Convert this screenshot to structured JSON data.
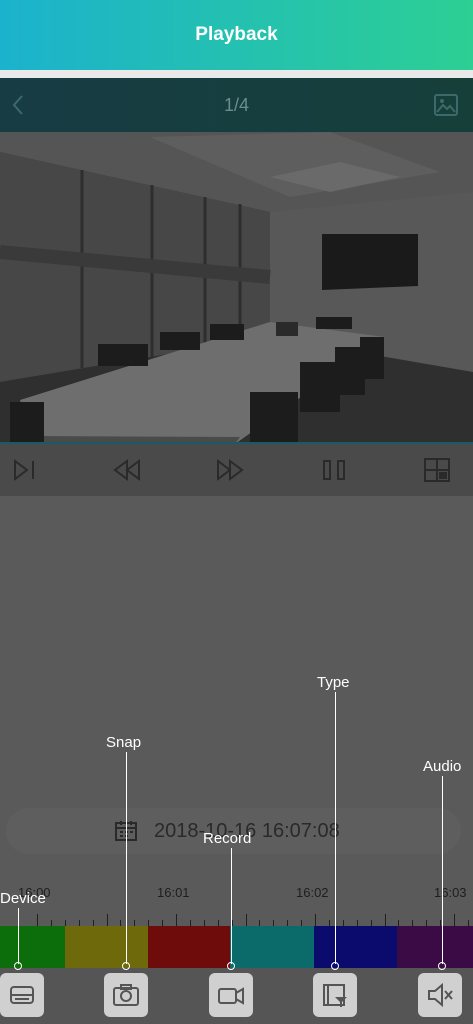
{
  "header": {
    "title": "Playback"
  },
  "subbar": {
    "page_indicator": "1/4"
  },
  "timeline": {
    "datetime": "2018-10-16 16:07:08",
    "tick_labels": [
      "16:00",
      "16:01",
      "16:02",
      "16:03"
    ],
    "segment_colors": [
      "#0b6e0b",
      "#6e6a0b",
      "#6e0b0b",
      "#0b6b6b",
      "#0b0b6e",
      "#3a0b44"
    ]
  },
  "toolbar": {
    "buttons": [
      "device",
      "snap",
      "record",
      "type",
      "audio"
    ]
  },
  "tips": {
    "device": "Device",
    "snap": "Snap",
    "record": "Record",
    "type": "Type",
    "audio": "Audio"
  },
  "colors": {
    "header_gradient_start": "#1bb2cd",
    "header_gradient_end": "#2dcf94",
    "overlay": "#5a5a5a"
  }
}
